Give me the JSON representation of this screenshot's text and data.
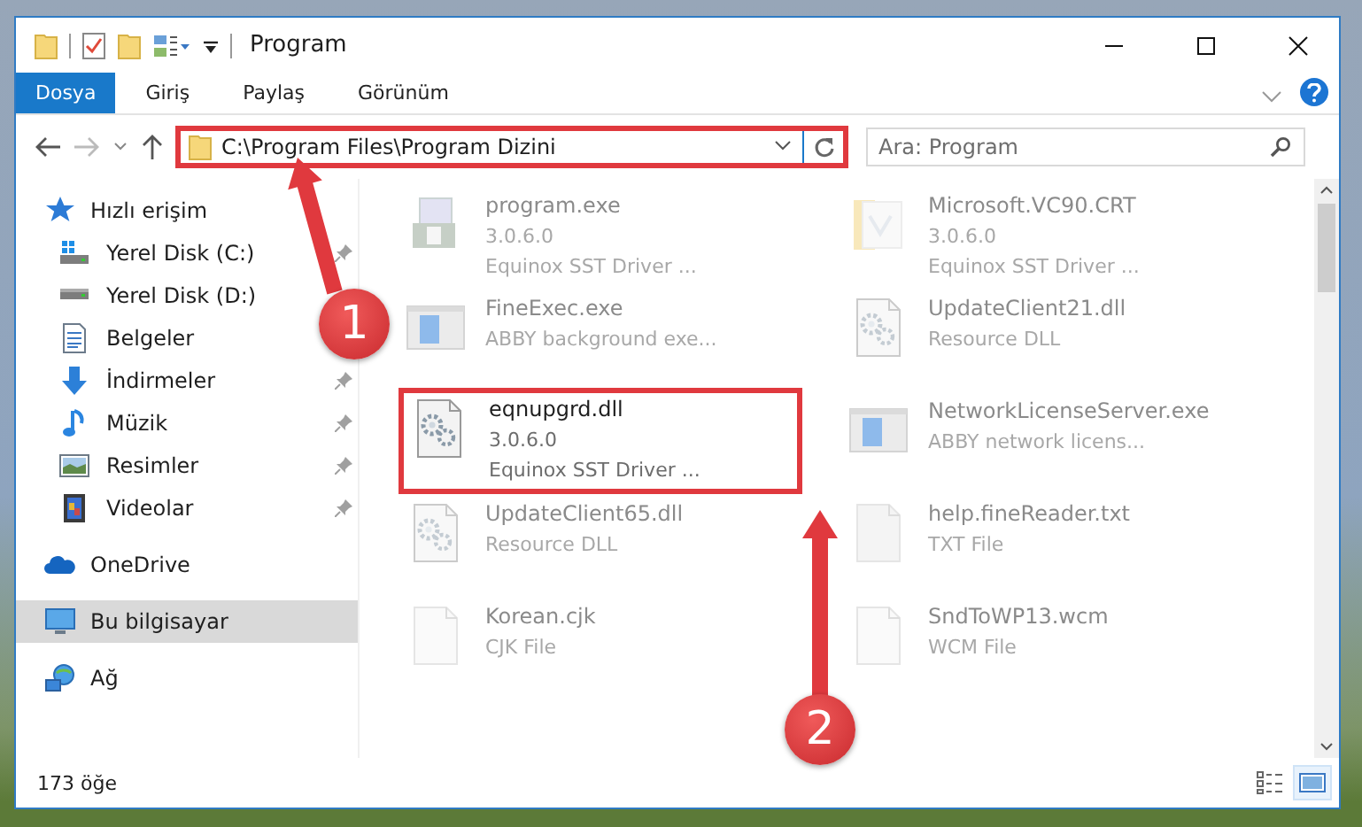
{
  "window": {
    "title": "Program"
  },
  "ribbon_tabs": [
    {
      "label": "Dosya",
      "selected": true
    },
    {
      "label": "Giriş",
      "selected": false
    },
    {
      "label": "Paylaş",
      "selected": false
    },
    {
      "label": "Görünüm",
      "selected": false
    }
  ],
  "address": {
    "path": "C:\\Program Files\\Program Dizini",
    "highlighted": true
  },
  "search": {
    "placeholder": "Ara: Program"
  },
  "sidebar": {
    "items": [
      {
        "label": "Hızlı erişim",
        "kind": "star",
        "selected": false,
        "children": [
          {
            "label": "Yerel Disk (C:)",
            "kind": "drive-windows",
            "pinned": true,
            "selected": false
          },
          {
            "label": "Yerel Disk (D:)",
            "kind": "drive",
            "pinned": false,
            "selected": false
          },
          {
            "label": "Belgeler",
            "kind": "document",
            "pinned": false,
            "selected": false
          },
          {
            "label": "İndirmeler",
            "kind": "download",
            "pinned": true,
            "selected": false
          },
          {
            "label": "Müzik",
            "kind": "music",
            "pinned": true,
            "selected": false
          },
          {
            "label": "Resimler",
            "kind": "pictures",
            "pinned": true,
            "selected": false
          },
          {
            "label": "Videolar",
            "kind": "videos",
            "pinned": true,
            "selected": false
          }
        ]
      },
      {
        "label": "OneDrive",
        "kind": "cloud",
        "selected": false
      },
      {
        "label": "Bu bilgisayar",
        "kind": "computer",
        "selected": true
      },
      {
        "label": "Ağ",
        "kind": "network",
        "selected": false
      }
    ]
  },
  "files": [
    {
      "name": "program.exe",
      "details": [
        "3.0.6.0",
        "Equinox SST Driver ..."
      ],
      "kind": "installer",
      "highlighted": false
    },
    {
      "name": "Microsoft.VC90.CRT",
      "details": [
        "3.0.6.0",
        "Equinox SST Driver ..."
      ],
      "kind": "folder",
      "highlighted": false
    },
    {
      "name": "FineExec.exe",
      "details": [
        "ABBY background exe..."
      ],
      "kind": "window",
      "highlighted": false
    },
    {
      "name": "UpdateClient21.dll",
      "details": [
        "Resource DLL"
      ],
      "kind": "dll",
      "highlighted": false
    },
    {
      "name": "eqnupgrd.dll",
      "details": [
        "3.0.6.0",
        "Equinox SST Driver ..."
      ],
      "kind": "dll",
      "highlighted": true
    },
    {
      "name": "NetworkLicenseServer.exe",
      "details": [
        "ABBY network licens..."
      ],
      "kind": "window",
      "highlighted": false
    },
    {
      "name": "UpdateClient65.dll",
      "details": [
        "Resource DLL"
      ],
      "kind": "dll",
      "highlighted": false
    },
    {
      "name": "help.fineReader.txt",
      "details": [
        "TXT File"
      ],
      "kind": "text",
      "highlighted": false
    },
    {
      "name": "Korean.cjk",
      "details": [
        "CJK File"
      ],
      "kind": "blank",
      "highlighted": false
    },
    {
      "name": "SndToWP13.wcm",
      "details": [
        "WCM File"
      ],
      "kind": "blank",
      "highlighted": false
    }
  ],
  "status_bar": {
    "item_count": "173 öğe",
    "views": [
      {
        "kind": "details",
        "selected": false
      },
      {
        "kind": "large-icons",
        "selected": true
      }
    ]
  },
  "callouts": [
    {
      "number": "1"
    },
    {
      "number": "2"
    }
  ]
}
